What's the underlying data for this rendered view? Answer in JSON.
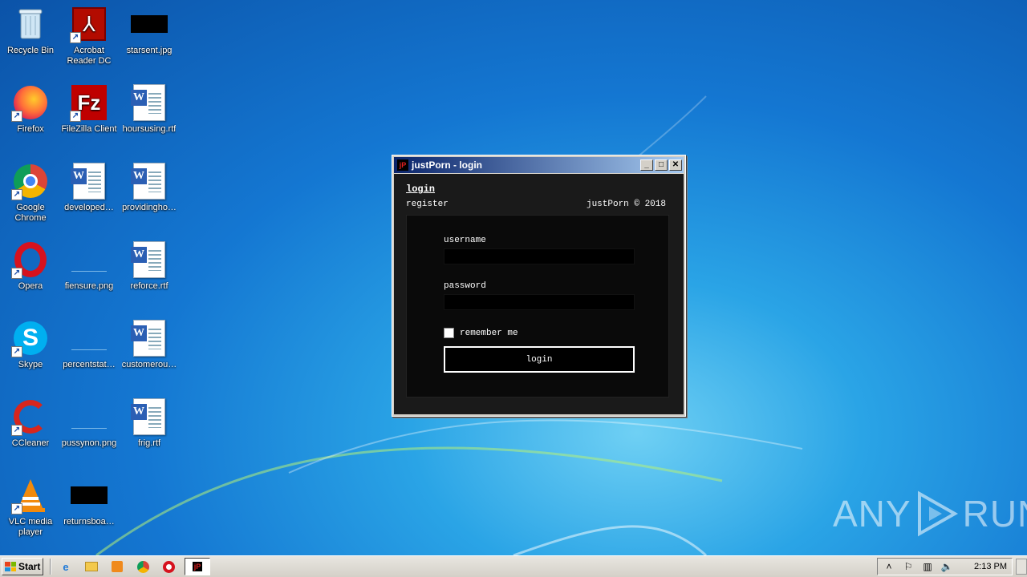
{
  "desktop": {
    "icons": [
      {
        "label": "Recycle Bin",
        "icon": "recycle-bin-icon"
      },
      {
        "label": "Acrobat Reader DC",
        "icon": "acrobat-icon"
      },
      {
        "label": "starsent.jpg",
        "icon": "image-file-icon"
      },
      {
        "label": "Firefox",
        "icon": "firefox-icon"
      },
      {
        "label": "FileZilla Client",
        "icon": "filezilla-icon"
      },
      {
        "label": "hoursusing.rtf",
        "icon": "word-document-icon"
      },
      {
        "label": "Google Chrome",
        "icon": "chrome-icon"
      },
      {
        "label": "developed…",
        "icon": "word-document-icon"
      },
      {
        "label": "providingho…",
        "icon": "word-document-icon"
      },
      {
        "label": "Opera",
        "icon": "opera-icon"
      },
      {
        "label": "fiensure.png",
        "icon": "image-file-icon"
      },
      {
        "label": "reforce.rtf",
        "icon": "word-document-icon"
      },
      {
        "label": "Skype",
        "icon": "skype-icon"
      },
      {
        "label": "percentstat…",
        "icon": "image-file-icon"
      },
      {
        "label": "customerou…",
        "icon": "word-document-icon"
      },
      {
        "label": "CCleaner",
        "icon": "ccleaner-icon"
      },
      {
        "label": "pussynon.png",
        "icon": "image-file-icon"
      },
      {
        "label": "frig.rtf",
        "icon": "word-document-icon"
      },
      {
        "label": "VLC media player",
        "icon": "vlc-icon"
      },
      {
        "label": "returnsboa…",
        "icon": "image-file-icon"
      }
    ]
  },
  "window": {
    "title": "justPorn - login",
    "app_glyph": "jP",
    "nav_login": "login",
    "nav_register": "register",
    "copyright": "justPorn ©  2018",
    "username_label": "username",
    "password_label": "password",
    "username_value": "",
    "password_value": "",
    "remember_label": "remember me",
    "remember_checked": false,
    "login_button": "login"
  },
  "watermark": {
    "left": "ANY",
    "right": "RUN"
  },
  "taskbar": {
    "start_label": "Start",
    "quick_launch": [
      "ie-icon",
      "folder-icon",
      "media-player-icon",
      "chrome-icon",
      "opera-icon"
    ],
    "active_task_glyph": "jP",
    "clock": "2:13 PM"
  },
  "colors": {
    "desktop_blue": "#1477d2",
    "title_gradient_start": "#0a246a",
    "title_gradient_end": "#a6caf0",
    "client_bg": "#1a1a1a"
  }
}
